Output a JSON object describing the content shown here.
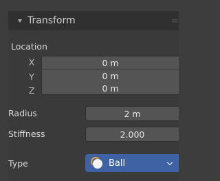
{
  "header": {
    "title": "Transform"
  },
  "location": {
    "label": "Location",
    "x": {
      "axis": "X",
      "value": "0 m"
    },
    "y": {
      "axis": "Y",
      "value": "0 m"
    },
    "z": {
      "axis": "Z",
      "value": "0 m"
    }
  },
  "radius": {
    "label": "Radius",
    "value": "2 m"
  },
  "stiffness": {
    "label": "Stiffness",
    "value": "2.000"
  },
  "type": {
    "label": "Type",
    "selected": "Ball",
    "icon": "ball-icon",
    "accent": "#3f62a4"
  }
}
